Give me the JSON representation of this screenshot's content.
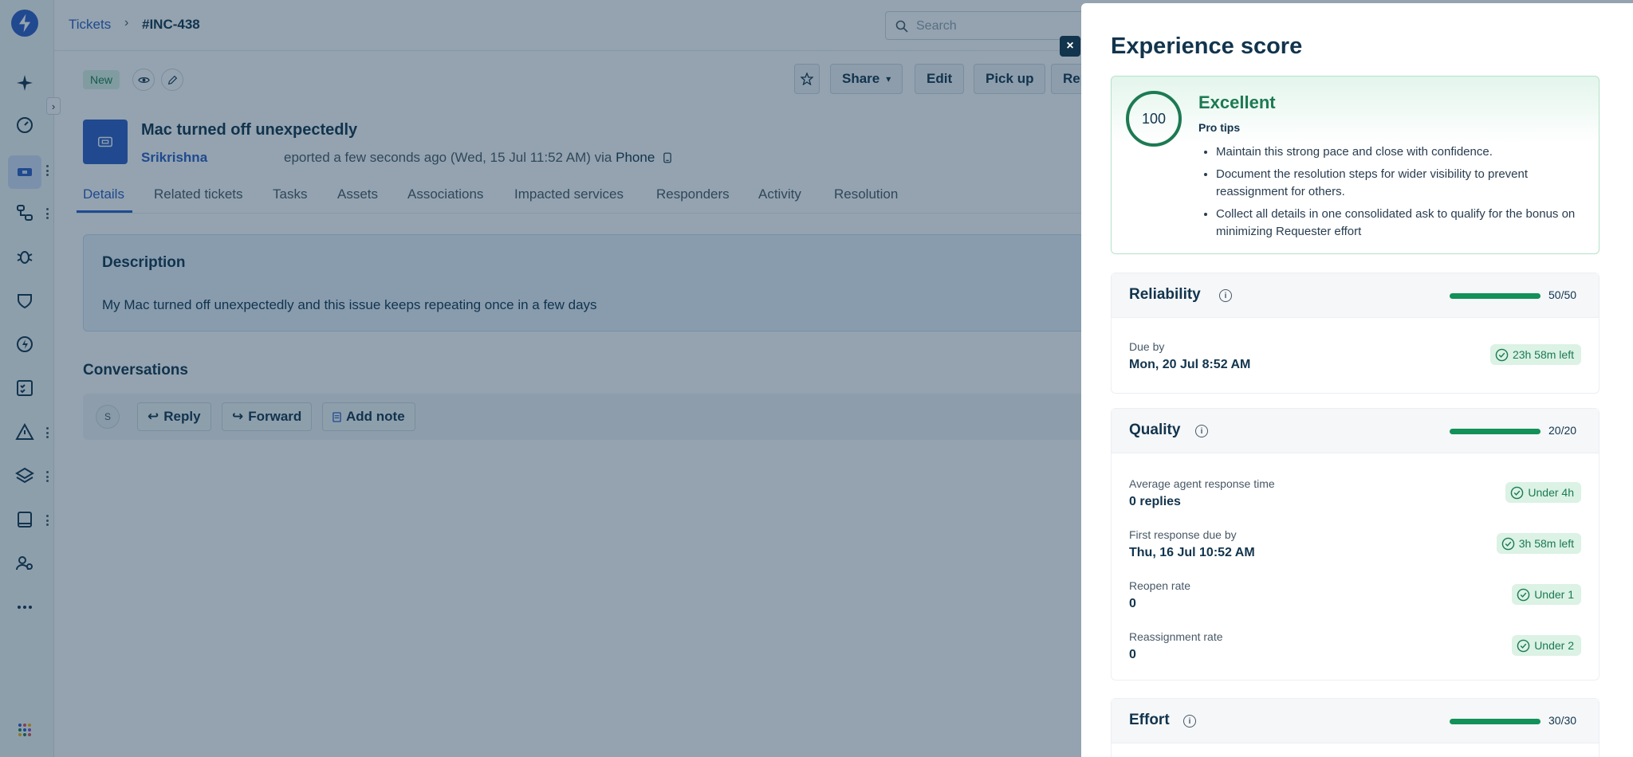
{
  "header": {
    "breadcrumb_link": "Tickets",
    "breadcrumb_sep": "›",
    "breadcrumb_current": "#INC-438",
    "search_placeholder": "Search"
  },
  "toolbar": {
    "status_tag": "New",
    "share_label": "Share",
    "edit_label": "Edit",
    "pickup_label": "Pick up",
    "reply_label": "Rep"
  },
  "ticket": {
    "title": "Mac turned off unexpectedly",
    "requester": "Srikrishna",
    "meta_prefix": "eported a few seconds ago (Wed, 15 Jul 11:52 AM) via",
    "meta_channel": "Phone"
  },
  "tabs": [
    {
      "label": "Details"
    },
    {
      "label": "Related tickets"
    },
    {
      "label": "Tasks"
    },
    {
      "label": "Assets"
    },
    {
      "label": "Associations"
    },
    {
      "label": "Impacted services"
    },
    {
      "label": "Responders"
    },
    {
      "label": "Activity"
    },
    {
      "label": "Resolution"
    }
  ],
  "description": {
    "heading": "Description",
    "body": "My Mac turned off unexpectedly and this issue keeps repeating once in a few days"
  },
  "conversations": {
    "heading": "Conversations",
    "avatar_initial": "S",
    "reply_label": "Reply",
    "forward_label": "Forward",
    "note_label": "Add note"
  },
  "drawer": {
    "close_label": "×",
    "title": "Experience score",
    "score": {
      "value": "100",
      "rating": "Excellent",
      "tips_heading": "Pro tips",
      "tips": [
        "Maintain this strong pace and close with confidence.",
        "Document the resolution steps for wider visibility to prevent reassignment for others.",
        "Collect all details in one consolidated ask to qualify for the bonus on minimizing Requester effort"
      ]
    },
    "reliability": {
      "title": "Reliability",
      "score_text": "50/50",
      "fill": 1.0,
      "rows": [
        {
          "label": "Due by",
          "value": "Mon, 20 Jul 8:52 AM",
          "pill": "23h 58m left"
        }
      ]
    },
    "quality": {
      "title": "Quality",
      "score_text": "20/20",
      "fill": 1.0,
      "rows": [
        {
          "label": "Average agent response time",
          "value": "0 replies",
          "pill": "Under 4h"
        },
        {
          "label": "First response due by",
          "value": "Thu, 16 Jul 10:52 AM",
          "pill": "3h 58m left"
        },
        {
          "label": "Reopen rate",
          "value": "0",
          "pill": "Under 1"
        },
        {
          "label": "Reassignment rate",
          "value": "0",
          "pill": "Under 2"
        }
      ]
    },
    "effort": {
      "title": "Effort",
      "score_text": "30/30",
      "fill": 1.0
    }
  },
  "colors": {
    "accent_blue": "#2c5cc5",
    "success_green": "#1c7a52",
    "bar_green": "#129158",
    "pill_bg": "#dbf2e5",
    "overlay": "rgba(18,52,77,0.45)"
  }
}
